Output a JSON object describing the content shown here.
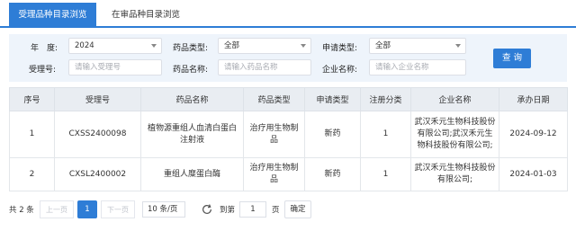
{
  "tabs": [
    {
      "label": "受理品种目录浏览"
    },
    {
      "label": "在审品种目录浏览"
    }
  ],
  "filter": {
    "year_label": "年　度:",
    "year_value": "2024",
    "drug_type_label": "药品类型:",
    "drug_type_value": "全部",
    "apply_type_label": "申请类型:",
    "apply_type_value": "全部",
    "accept_no_label": "受理号:",
    "accept_no_placeholder": "请输入受理号",
    "drug_name_label": "药品名称:",
    "drug_name_placeholder": "请输入药品名称",
    "company_label": "企业名称:",
    "company_placeholder": "请输入企业名称",
    "search_label": "查 询"
  },
  "table": {
    "headers": [
      "序号",
      "受理号",
      "药品名称",
      "药品类型",
      "申请类型",
      "注册分类",
      "企业名称",
      "承办日期"
    ],
    "rows": [
      {
        "no": "1",
        "accept_no": "CXSS2400098",
        "drug_name": "植物源重组人血清白蛋白注射液",
        "drug_type": "治疗用生物制品",
        "apply_type": "新药",
        "reg_class": "1",
        "company": "武汉禾元生物科技股份有限公司;武汉禾元生物科技股份有限公司;",
        "date": "2024-09-12"
      },
      {
        "no": "2",
        "accept_no": "CXSL2400002",
        "drug_name": "重组人糜蛋白酶",
        "drug_type": "治疗用生物制品",
        "apply_type": "新药",
        "reg_class": "1",
        "company": "武汉禾元生物科技股份有限公司;",
        "date": "2024-01-03"
      }
    ]
  },
  "pager": {
    "total": "共 2 条",
    "prev": "上一页",
    "current_page": "1",
    "next": "下一页",
    "page_size": "10 条/页",
    "goto_label": "到第",
    "goto_value": "1",
    "page_unit": "页",
    "confirm": "确定"
  },
  "colors": {
    "accent": "#2e7dd6",
    "filter_bg": "#eef4fb"
  },
  "icons": {
    "refresh": "refresh-icon",
    "dropdown": "chevron-down-icon"
  }
}
